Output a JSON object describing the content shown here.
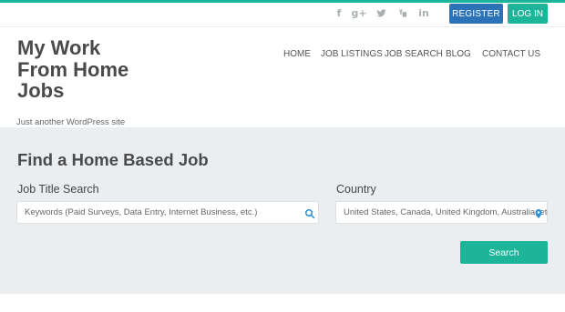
{
  "topbar": {
    "social": [
      {
        "icon": "facebook-icon",
        "glyph": "f"
      },
      {
        "icon": "google-plus-icon",
        "glyph": "g+"
      },
      {
        "icon": "twitter-icon",
        "glyph": ""
      },
      {
        "icon": "youtube-icon",
        "glyph": ""
      },
      {
        "icon": "linkedin-icon",
        "glyph": "in"
      }
    ],
    "register_label": "REGISTER",
    "login_label": "LOG IN"
  },
  "site": {
    "title": "My Work From Home Jobs",
    "tagline": "Just another WordPress site"
  },
  "nav": {
    "items": [
      "HOME",
      "JOB LISTINGS",
      "JOB SEARCH",
      "BLOG",
      "CONTACT US"
    ]
  },
  "search": {
    "heading": "Find a Home Based Job",
    "job_label": "Job Title Search",
    "job_placeholder": "Keywords (Paid Surveys, Data Entry, Internet Business, etc.)",
    "country_label": "Country",
    "country_placeholder": "United States, Canada, United Kingdom, Australia, etc.",
    "submit_label": "Search"
  },
  "colors": {
    "accent": "#1cb59a",
    "register": "#2b73b6",
    "panel": "#ebeef0"
  }
}
